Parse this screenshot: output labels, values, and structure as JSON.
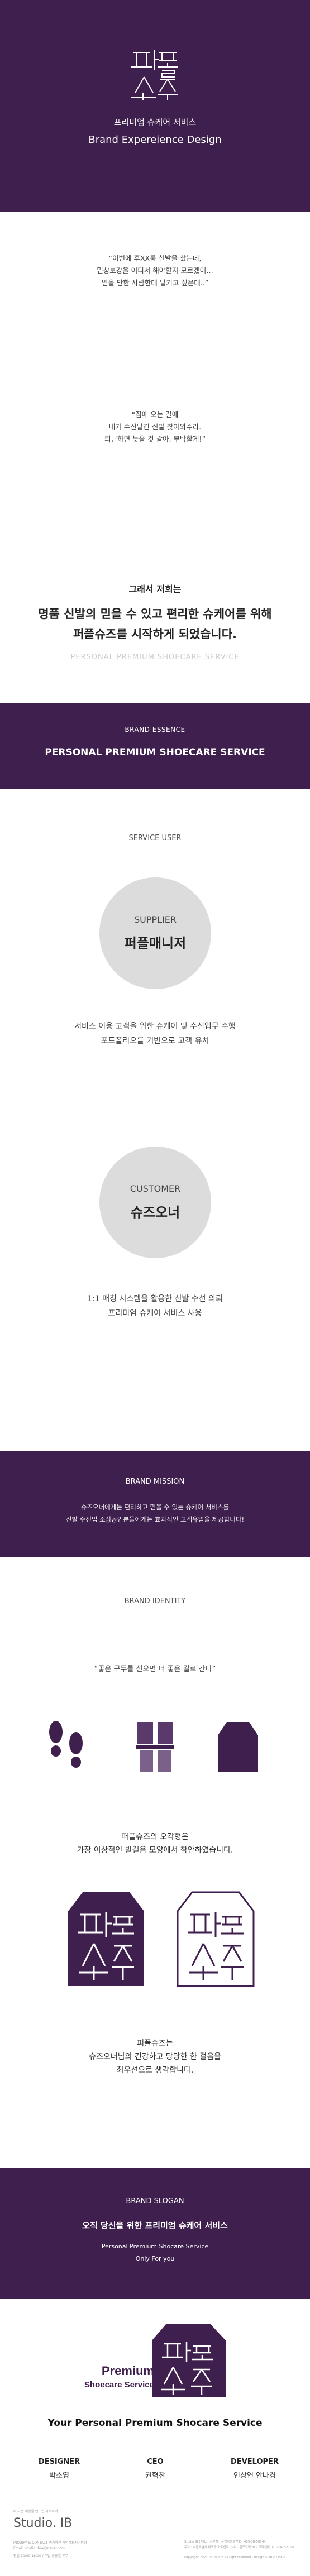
{
  "hero": {
    "logo_text": [
      "퍼",
      "플",
      "슈",
      "즈"
    ],
    "subtitle_ko": "프리미엄 슈케어 서비스",
    "subtitle_en": "Brand Expereience Design"
  },
  "quotes": {
    "q1": [
      "“이번에 후XX룸 신발을 샀는데,",
      "밑창보강을 어디서 해야할지 모르겠어…",
      "믿을 만한 사람한테 맡기고 싶은데..”"
    ],
    "q2": [
      "“집에 오는 길에",
      "내가 수선맡긴 신발 찾아와주라.",
      "퇴근하면 늦을 것 같아. 부탁할게!”"
    ],
    "tagline_intro": "그래서 저희는",
    "tagline_main": [
      "명품 신발의 믿을 수 있고 편리한 슈케어를 위해",
      "퍼플슈즈를 시작하게 되었습니다."
    ],
    "tagline_en": "PERSONAL PREMIUM SHOECARE SERVICE"
  },
  "essence": {
    "title": "BRAND ESSENCE",
    "statement": "PERSONAL PREMIUM SHOECARE SERVICE"
  },
  "service_user": {
    "title": "SERVICE USER",
    "supplier": {
      "en": "SUPPLIER",
      "ko": "퍼플매니저",
      "desc": [
        "서비스 이용 고객을 위한 슈케어 및 수선업무 수행",
        "포트폴리오를 기반으로 고객 유치"
      ]
    },
    "customer": {
      "en": "CUSTOMER",
      "ko": "슈즈오너",
      "desc": [
        "1:1 매칭 시스템을 활용한 신발 수선 의뢰",
        "프리미엄 슈케어 서비스 사용"
      ]
    }
  },
  "mission": {
    "title": "BRAND MISSION",
    "text": [
      "슈즈오너에게는 편리하고 믿을 수 있는 슈케어 서비스를",
      "신발 수선업 소상공인분들에게는 효과적인 고객유입을 제공합니다!"
    ]
  },
  "identity": {
    "title": "BRAND IDENTITY",
    "quote": "“좋은 구두를 신으면 더 좋은 길로 간다”",
    "icons": [
      "footprints-icon",
      "shoe-sole-icon",
      "shoe-heel-icon"
    ],
    "desc1": [
      "퍼플슈즈의 오각형은",
      "가장 이상적인 발걸음 모양에서 착안하였습니다."
    ],
    "desc2": [
      "퍼플슈즈는",
      "슈즈오너님의 건강하고 당당한 한 걸음을",
      "최우선으로 생각합니다."
    ]
  },
  "slogan": {
    "title": "BRAND SLOGAN",
    "main": "오직 당신을 위한 프리미엄 슈케어 서비스",
    "en1": "Personal Premium Shocare Service",
    "en2": "Only For you"
  },
  "brand": {
    "mark_line1": "Premium",
    "mark_line2": "Shoecare Service",
    "tagline": "Your Personal Premium Shocare Service"
  },
  "credits": [
    {
      "role": "DESIGNER",
      "name": "박소영"
    },
    {
      "role": "CEO",
      "name": "권혁찬"
    },
    {
      "role": "DEVELOPER",
      "name": "인상연 안나경"
    }
  ],
  "footer": {
    "top": "더 나은 세상을 만드는 디자이너",
    "studio": "Studio. IB",
    "f1": "INQUIRY & CONTACT    이용약관    개인정보처리방침",
    "f2": "Email: studio_ibox@naver.com",
    "f3": "평일 10:00-18:00 / 주말·공휴일 휴무",
    "r1": "Studio IB | 대표 : 김부성 | 사업자등록번호 : 409-38-00744",
    "r2": "주소 : 서울특별시 마포구 와우산로 29다 7필드트랙 3F | 고객센터 010-3418-5094",
    "r3": "copyright 2021. Studio IB All right reserved - design STUDIO IBOX"
  },
  "colors": {
    "primary": "#3f1f4d",
    "gray_circle": "#dcdcdc"
  }
}
